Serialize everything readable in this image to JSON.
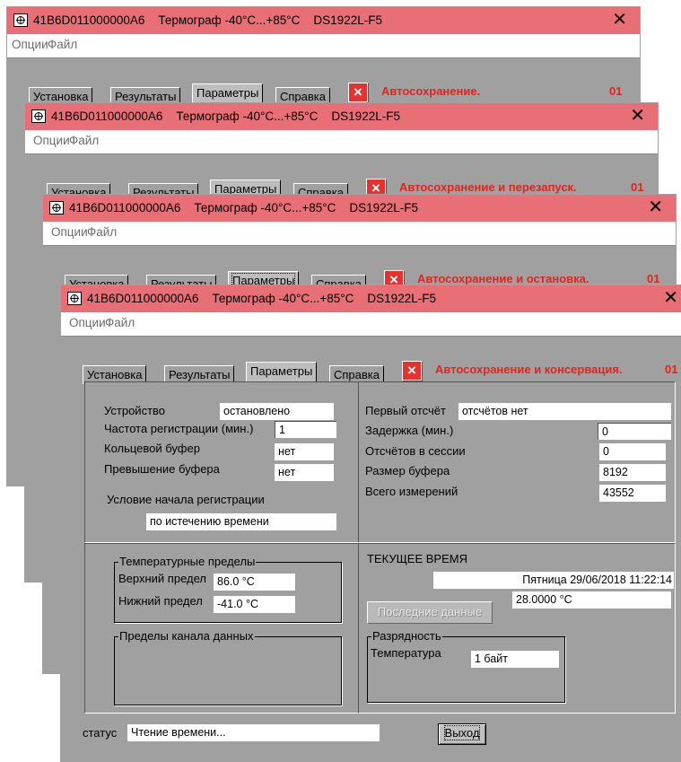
{
  "windows": [
    {
      "title": "41B6D011000000A6    Термограф -40°C...+85°C    DS1922L-F5",
      "close": "✕",
      "menu": [
        "Опции",
        "Файл"
      ],
      "tabs": [
        "Установка",
        "Результаты",
        "Параметры",
        "Справка"
      ],
      "message": "Автосохранение.",
      "count": "01"
    },
    {
      "title": "41B6D011000000A6    Термограф -40°C...+85°C    DS1922L-F5",
      "close": "✕",
      "menu": [
        "Опции",
        "Файл"
      ],
      "tabs": [
        "Установка",
        "Результаты",
        "Параметры",
        "Справка"
      ],
      "message": "Автосохранение и перезапуск.",
      "count": "01"
    },
    {
      "title": "41B6D011000000A6    Термограф -40°C...+85°C    DS1922L-F5",
      "close": "✕",
      "menu": [
        "Опции",
        "Файл"
      ],
      "tabs": [
        "Установка",
        "Результаты",
        "Параметры",
        "Справка"
      ],
      "message": "Автосохранение и остановка.",
      "count": "01"
    },
    {
      "title": "41B6D011000000A6    Термограф -40°C...+85°C    DS1922L-F5",
      "close": "✕",
      "menu": [
        "Опции",
        "Файл"
      ],
      "tabs": [
        "Установка",
        "Результаты",
        "Параметры",
        "Справка"
      ],
      "message": "Автосохранение и консервация.",
      "count": "01"
    }
  ],
  "x_button": "×",
  "params": {
    "device_label": "Устройство",
    "device_value": "остановлено",
    "rate_label": "Частота регистрации (мин.)",
    "rate_value": "1",
    "ring_label": "Кольцевой буфер",
    "ring_value": "нет",
    "overflow_label": "Превышение буфера",
    "overflow_value": "нет",
    "start_label": "Условие начала регистрации",
    "start_value": "по истечению времени"
  },
  "readings": {
    "first_label": "Первый отсчёт",
    "first_value": "отсчётов нет",
    "delay_label": "Задержка (мин.)",
    "delay_value": "0",
    "session_label": "Отсчётов в сессии",
    "session_value": "0",
    "buffer_label": "Размер буфера",
    "buffer_value": "8192",
    "total_label": "Всего измерений",
    "total_value": "43552"
  },
  "temp_limits": {
    "title": "Температурные пределы",
    "upper_label": "Верхний предел",
    "upper_value": "86.0 °C",
    "lower_label": "Нижний предел",
    "lower_value": "-41.0 °C"
  },
  "data_limits": {
    "title": "Пределы канала данных"
  },
  "current_time": {
    "title": "ТЕКУЩЕЕ ВРЕМЯ",
    "datetime": "Пятница 29/06/2018 11:22:14",
    "temperature": "28.0000 °C",
    "last_data_button": "Последние данные"
  },
  "resolution": {
    "title": "Разрядность",
    "temp_label": "Температура",
    "temp_value": "1 байт"
  },
  "status": {
    "label": "статус",
    "value": "Чтение времени...",
    "exit_button": "Выход"
  }
}
